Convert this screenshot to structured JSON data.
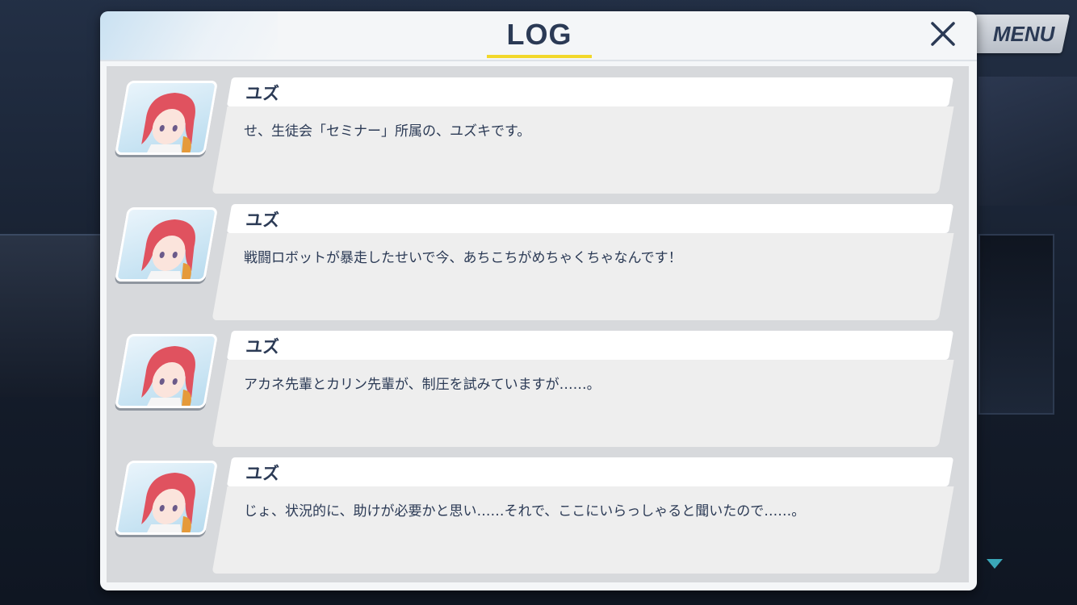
{
  "header": {
    "title": "LOG"
  },
  "menu": {
    "label": "MENU"
  },
  "colors": {
    "title_text": "#2b3a55",
    "title_underline": "#f2d82a",
    "panel_bg": "#f4f6f8",
    "list_bg": "#d7d9dc",
    "scroll_arrow": "#3aa7b8"
  },
  "icons": {
    "close": "close-icon",
    "scroll": "triangle-down-icon"
  },
  "log_entries": [
    {
      "speaker": "ユズ",
      "text": "せ、生徒会「セミナー」所属の、ユズキです。"
    },
    {
      "speaker": "ユズ",
      "text": "戦闘ロボットが暴走したせいで今、あちこちがめちゃくちゃなんです！"
    },
    {
      "speaker": "ユズ",
      "text": "アカネ先輩とカリン先輩が、制圧を試みていますが……。"
    },
    {
      "speaker": "ユズ",
      "text": "じょ、状況的に、助けが必要かと思い……それで、ここにいらっしゃると聞いたので……。"
    }
  ]
}
